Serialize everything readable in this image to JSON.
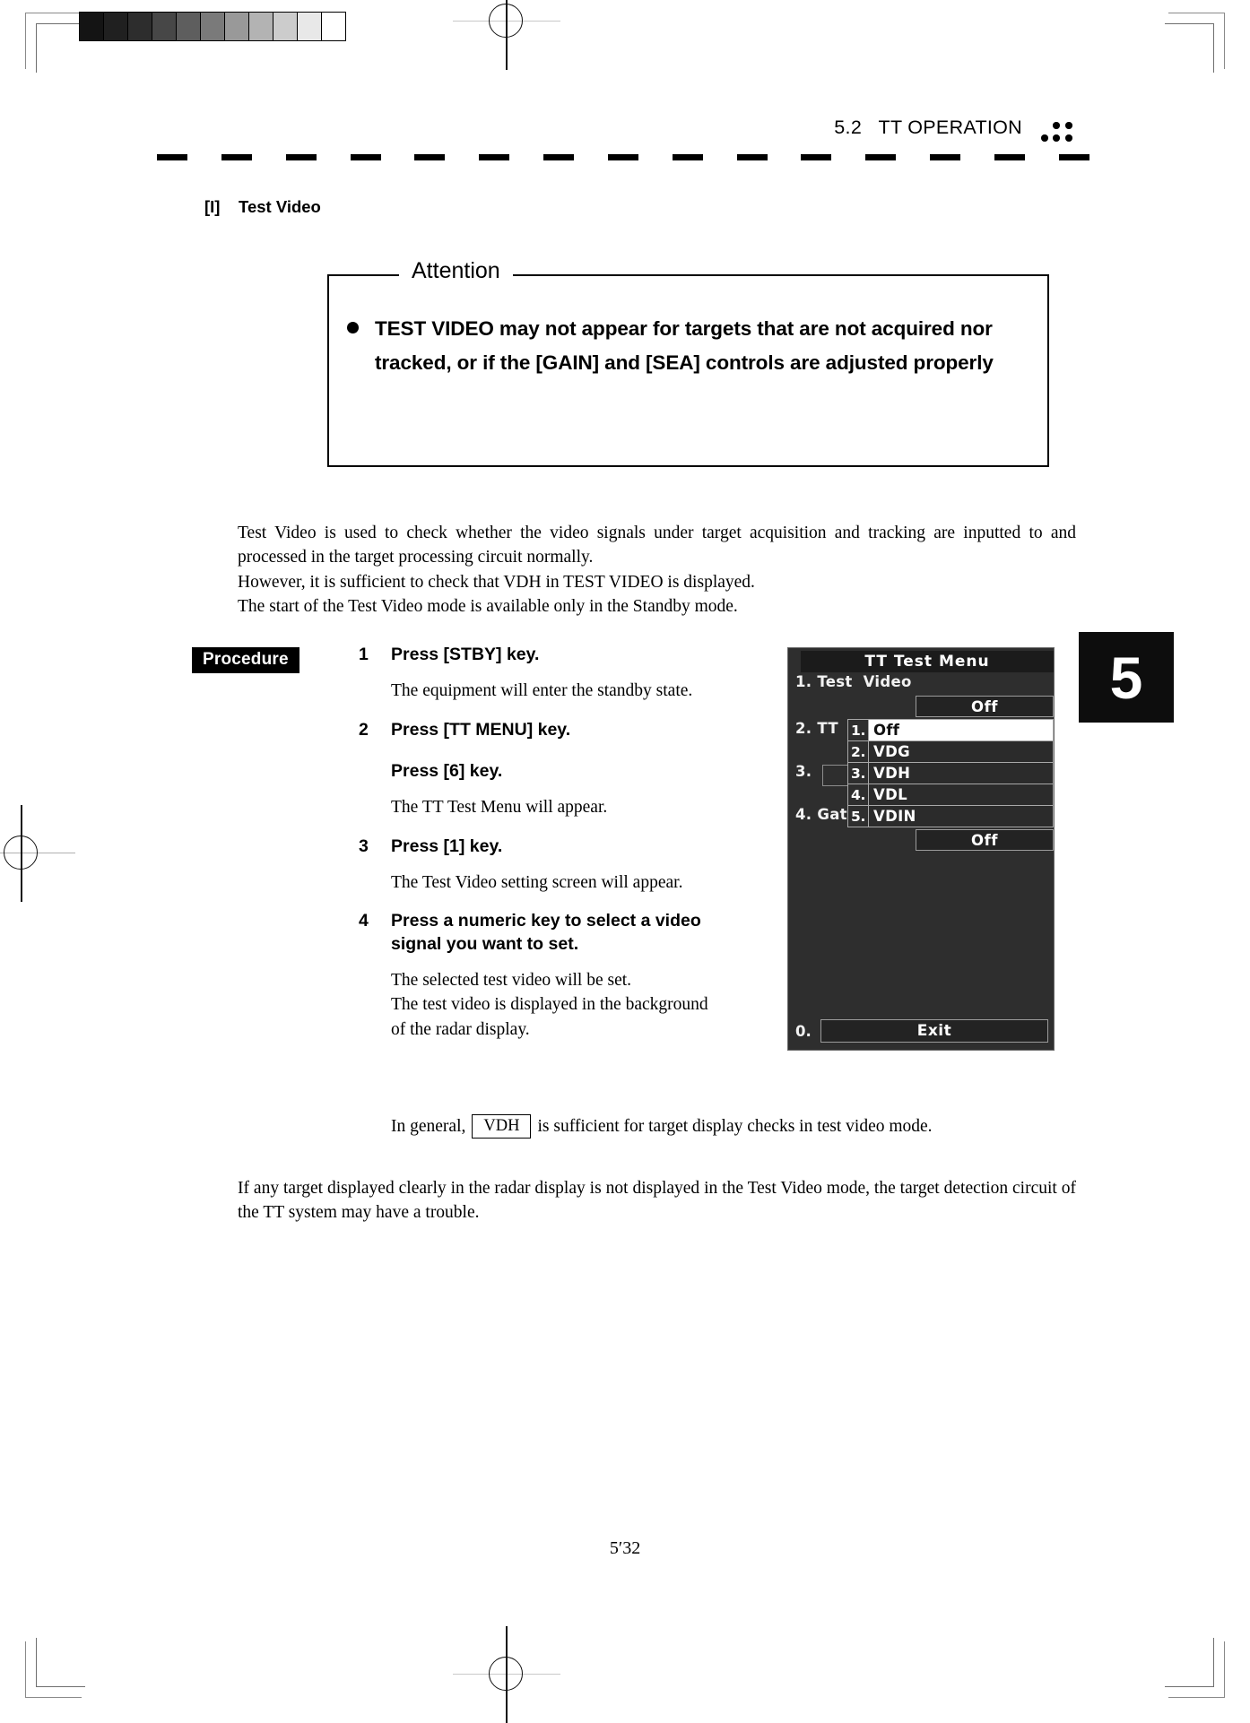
{
  "header": {
    "running_title": "5.2   TT OPERATION",
    "dots_icon": "five-dot-marker"
  },
  "chapter_tab": {
    "number": "5"
  },
  "section": {
    "heading": "[I]    Test Video"
  },
  "attention": {
    "legend": "Attention",
    "bullet_text": "TEST VIDEO may not appear for targets that are not acquired nor tracked, or if the [GAIN] and [SEA] controls are adjusted properly"
  },
  "intro": {
    "paragraph1": "Test Video is used to check whether the video signals under target acquisition and tracking are inputted to and processed in the target processing circuit normally.",
    "paragraph2": "However, it is sufficient to check that VDH in TEST VIDEO is displayed.",
    "paragraph3": "The start of the Test Video mode is available only in the Standby mode."
  },
  "procedure": {
    "label": "Procedure",
    "steps": [
      {
        "num": "1",
        "title": "Press [STBY] key.",
        "subtitle": "",
        "desc": "The equipment will enter the standby state."
      },
      {
        "num": "2",
        "title": "Press [TT MENU] key.",
        "subtitle": "Press [6] key.",
        "desc": "The TT Test Menu will appear."
      },
      {
        "num": "3",
        "title": "Press [1] key.",
        "subtitle": "",
        "desc": "The Test Video setting screen will appear."
      },
      {
        "num": "4",
        "title": "Press a numeric key to select a video signal you want to set.",
        "subtitle": "",
        "desc": "The selected test video will be set.\nThe test video is displayed in the background of the radar display."
      }
    ]
  },
  "vdh_note": {
    "before": "In general,",
    "boxed": "VDH",
    "after": "is sufficient for target display checks in test video mode."
  },
  "closing": {
    "paragraph": "If any target displayed clearly in the radar display is not displayed in the Test Video mode, the target detection circuit of the TT system may have a trouble."
  },
  "page": {
    "number": "5′32"
  },
  "menu_screenshot": {
    "title": "TT Test Menu",
    "rows": [
      {
        "label": "1. Test  Video",
        "value": "Off"
      },
      {
        "label": "2. TT",
        "value": ""
      },
      {
        "label": "3.",
        "value": ""
      },
      {
        "label": "4. Gat",
        "value": "Off"
      }
    ],
    "dropdown": [
      {
        "index": "1.",
        "label": "Off",
        "selected": true
      },
      {
        "index": "2.",
        "label": "VDG",
        "selected": false
      },
      {
        "index": "3.",
        "label": "VDH",
        "selected": false
      },
      {
        "index": "4.",
        "label": "VDL",
        "selected": false
      },
      {
        "index": "5.",
        "label": "VDIN",
        "selected": false
      }
    ],
    "exit": {
      "index": "0.",
      "label": "Exit"
    }
  },
  "greyscale_bar": {
    "swatches": [
      "#141414",
      "#202020",
      "#2d2d2d",
      "#474747",
      "#5e5e5e",
      "#7a7a7a",
      "#999999",
      "#b3b3b3",
      "#cccccc",
      "#e8e8e8",
      "#ffffff"
    ]
  },
  "colors": {
    "ink": "#000000",
    "paper": "#ffffff",
    "menu_bg": "#2e2e2e",
    "menu_titlebar": "#1b1b1b",
    "menu_border": "#9b9b9b",
    "tab_bg": "#0d0d0d"
  }
}
